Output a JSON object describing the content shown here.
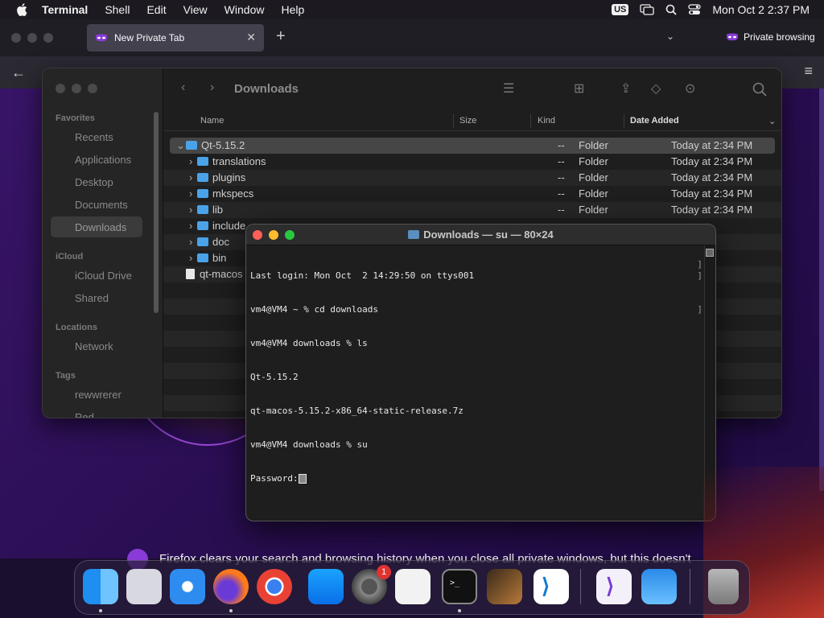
{
  "menubar": {
    "app": "Terminal",
    "items": [
      "Shell",
      "Edit",
      "View",
      "Window",
      "Help"
    ],
    "input_source": "US",
    "clock": "Mon Oct 2  2:37 PM"
  },
  "firefox": {
    "tab_title": "New Private Tab",
    "private_label": "Private browsing",
    "page_text": "Firefox clears your search and browsing history when you close all private windows, but this doesn't"
  },
  "finder": {
    "title": "Downloads",
    "sidebar": {
      "favorites_head": "Favorites",
      "favorites": [
        "Recents",
        "Applications",
        "Desktop",
        "Documents",
        "Downloads"
      ],
      "icloud_head": "iCloud",
      "icloud": [
        "iCloud Drive",
        "Shared"
      ],
      "locations_head": "Locations",
      "locations": [
        "Network"
      ],
      "tags_head": "Tags",
      "tags": [
        "rewwrerer",
        "Red"
      ]
    },
    "columns": {
      "name": "Name",
      "size": "Size",
      "kind": "Kind",
      "date": "Date Added"
    },
    "rows": [
      {
        "name": "Qt-5.15.2",
        "size": "--",
        "kind": "Folder",
        "date": "Today at 2:34 PM"
      },
      {
        "name": "translations",
        "size": "--",
        "kind": "Folder",
        "date": "Today at 2:34 PM"
      },
      {
        "name": "plugins",
        "size": "--",
        "kind": "Folder",
        "date": "Today at 2:34 PM"
      },
      {
        "name": "mkspecs",
        "size": "--",
        "kind": "Folder",
        "date": "Today at 2:34 PM"
      },
      {
        "name": "lib",
        "size": "--",
        "kind": "Folder",
        "date": "Today at 2:34 PM"
      },
      {
        "name": "include",
        "size": "",
        "kind": "",
        "date": ""
      },
      {
        "name": "doc",
        "size": "",
        "kind": "",
        "date": ""
      },
      {
        "name": "bin",
        "size": "",
        "kind": "",
        "date": ""
      },
      {
        "name": "qt-macos",
        "size": "",
        "kind": "",
        "date": ""
      }
    ]
  },
  "terminal": {
    "title": "Downloads — su — 80×24",
    "lines": [
      "Last login: Mon Oct  2 14:29:50 on ttys001",
      "vm4@VM4 ~ % cd downloads",
      "vm4@VM4 downloads % ls",
      "Qt-5.15.2",
      "qt-macos-5.15.2-x86_64-static-release.7z",
      "vm4@VM4 downloads % su",
      "Password:"
    ]
  },
  "dock": {
    "badge": "1",
    "apps": [
      "Finder",
      "Launchpad",
      "Safari",
      "Firefox",
      "Chrome",
      "App Store",
      "System Settings",
      "TextEdit",
      "Terminal",
      "Instruments",
      "Visual Studio Code",
      "Visual Studio",
      "Weather",
      "Trash"
    ]
  }
}
